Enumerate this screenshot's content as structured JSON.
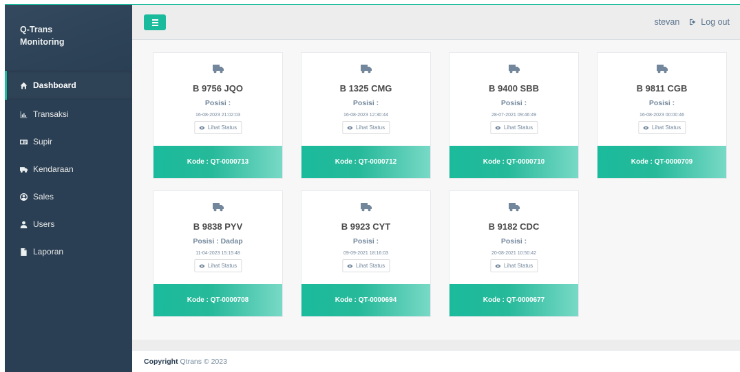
{
  "brand": {
    "line1": "Q-Trans",
    "line2": "Monitoring"
  },
  "menu": [
    {
      "label": "Dashboard",
      "icon": "home-icon",
      "active": true
    },
    {
      "label": "Transaksi",
      "icon": "bar-chart-icon",
      "active": false
    },
    {
      "label": "Supir",
      "icon": "id-card-icon",
      "active": false
    },
    {
      "label": "Kendaraan",
      "icon": "truck-icon",
      "active": false
    },
    {
      "label": "Sales",
      "icon": "user-circle-icon",
      "active": false
    },
    {
      "label": "Users",
      "icon": "user-icon",
      "active": false
    },
    {
      "label": "Laporan",
      "icon": "file-icon",
      "active": false
    }
  ],
  "topbar": {
    "username": "stevan",
    "logout_label": "Log out"
  },
  "vehicles": [
    {
      "plate": "B 9756 JQO",
      "posisi": "Posisi :",
      "time": "16-08-2023 21:02:03",
      "button": "Lihat Status",
      "kode": "Kode : QT-0000713"
    },
    {
      "plate": "B 1325 CMG",
      "posisi": "Posisi :",
      "time": "16-08-2023 12:30:44",
      "button": "Lihat Status",
      "kode": "Kode : QT-0000712"
    },
    {
      "plate": "B 9400 SBB",
      "posisi": "Posisi :",
      "time": "28-07-2021 09:46:49",
      "button": "Lihat Status",
      "kode": "Kode : QT-0000710"
    },
    {
      "plate": "B 9811 CGB",
      "posisi": "Posisi :",
      "time": "16-08-2023 00:00:46",
      "button": "Lihat Status",
      "kode": "Kode : QT-0000709"
    },
    {
      "plate": "B 9838 PYV",
      "posisi": "Posisi : Dadap",
      "time": "11-04-2023 15:15:48",
      "button": "Lihat Status",
      "kode": "Kode : QT-0000708"
    },
    {
      "plate": "B 9923 CYT",
      "posisi": "Posisi :",
      "time": "09-09-2021 18:16:03",
      "button": "Lihat Status",
      "kode": "Kode : QT-0000694"
    },
    {
      "plate": "B 9182 CDC",
      "posisi": "Posisi :",
      "time": "20-08-2021 10:50:42",
      "button": "Lihat Status",
      "kode": "Kode : QT-0000677"
    }
  ],
  "footer": {
    "copyright_bold": "Copyright",
    "copyright_text": " Qtrans © 2023"
  },
  "colors": {
    "accent": "#1abb9c",
    "sidebar": "#2a3f54",
    "text": "#73879c"
  }
}
